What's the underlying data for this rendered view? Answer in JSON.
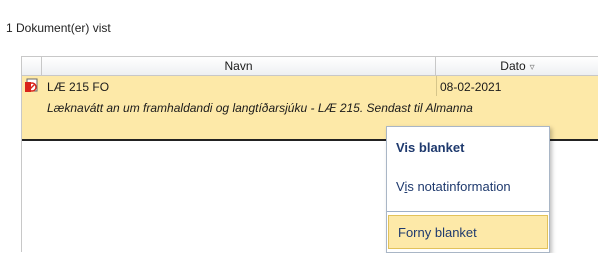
{
  "status": {
    "count_text": "1 Dokument(er) vist"
  },
  "table": {
    "columns": [
      {
        "label": ""
      },
      {
        "label": "Navn"
      },
      {
        "label": "Dato"
      }
    ],
    "sort_icon": "sort-descending-icon",
    "rows": [
      {
        "icon": "pdf-document-icon",
        "title": "LÆ 215 FO",
        "date": "08-02-2021",
        "description": "Læknavátt an um framhaldandi og langtíðarsjúku - LÆ 215. Sendast til Almanna"
      }
    ]
  },
  "context_menu": {
    "items": [
      {
        "label": "Vis blanket",
        "bold": true
      },
      {
        "label_pre": "V",
        "label_accel": "i",
        "label_post": "s notatinformation"
      },
      {
        "label": "Forny blanket",
        "highlighted": true
      }
    ]
  },
  "colors": {
    "row_highlight": "#fde9a8",
    "menu_text": "#1f3a6e"
  }
}
